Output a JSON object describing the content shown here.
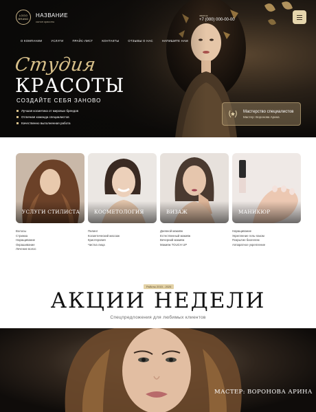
{
  "header": {
    "logo_line1": "LOGO",
    "logo_line2": "BRAND",
    "brand_name": "НАЗВАНИЕ",
    "brand_sub": "салон красоты",
    "phone_label": "звонок",
    "phone": "+7 (000) 000-00-00"
  },
  "nav": [
    "О КОМПАНИИ",
    "УСЛУГИ",
    "ПРАЙС-ЛИСТ",
    "КОНТАКТЫ",
    "ОТЗЫВЫ О НАС",
    "НАПИШИТЕ НАМ"
  ],
  "hero": {
    "script_title": "Студия",
    "main_title": "КРАСОТЫ",
    "subtitle": "СОЗДАЙТЕ СЕБЯ ЗАНОВО",
    "features": [
      "Лучшая косметика от мировых брендов",
      "Отличная команда специалистов",
      "Качественно выполненная работа"
    ],
    "master_badge_title": "Мастерство специалистов",
    "master_badge_sub": "Мастер: Воронова Арина"
  },
  "services": [
    {
      "title": "УСЛУГИ СТИЛИСТА",
      "items": [
        "Волосы",
        "Стрижка",
        "Наращивание",
        "Окрашивание",
        "Лечение волос"
      ]
    },
    {
      "title": "КОСМЕТОЛОГИЯ",
      "items": [
        "Пилинг",
        "Косметический массаж",
        "Криотерапия",
        "Чистка лица"
      ]
    },
    {
      "title": "ВИЗАЖ",
      "items": [
        "Дневной макияж",
        "Естественный макияж",
        "Вечерний макияж",
        "Макияж TOUCH UP"
      ]
    },
    {
      "title": "МАНИКЮР",
      "items": [
        "Наращивание",
        "Укрепление гель-лаком",
        "Покрытие биогелем",
        "Аппаратное укрепление"
      ]
    }
  ],
  "promo": {
    "years": "Работы 2015 - 2025",
    "title": "АКЦИИ НЕДЕЛИ",
    "subtitle": "Спецпредложения для любимых клиентов",
    "master_name": "МАСТЕР: ВОРОНОВА АРИНА"
  },
  "colors": {
    "gold": "#d8c08a",
    "dark": "#0d0b09",
    "beige": "#e6d6ad"
  }
}
